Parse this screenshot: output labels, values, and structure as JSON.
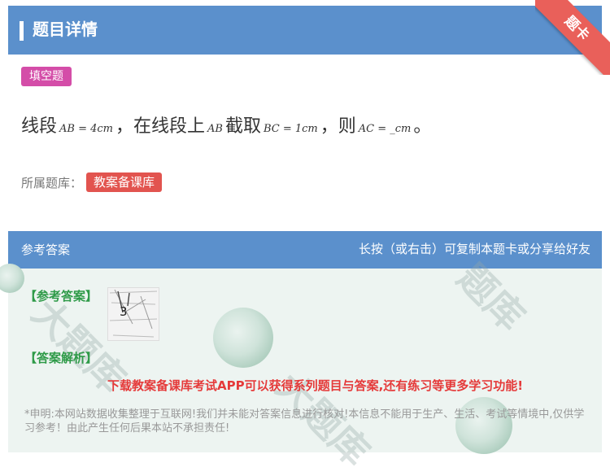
{
  "header": {
    "title": "题目详情",
    "ribbon": "题卡"
  },
  "question": {
    "type_tag": "填空题",
    "text_1": "线段",
    "math_1": "AB = 4cm",
    "text_2": "，在线段上",
    "math_2": "AB",
    "text_3": "截取",
    "math_3": "BC = 1cm",
    "text_4": "，则",
    "math_4": "AC = _cm",
    "text_5": "。",
    "bank_label": "所属题库：",
    "bank_name": "教案备课库"
  },
  "answer": {
    "header_left": "参考答案",
    "header_right": "长按（或右击）可复制本题卡或分享给好友",
    "ref_label": "【参考答案】",
    "answer_value": "3",
    "analysis_label": "【答案解析】",
    "promo": "下载教案备课库考试APP可以获得系列题目与答案,还有练习等更多学习功能!",
    "disclaimer": "*申明:本网站数据收集整理于互联网!我们并未能对答案信息进行核对!本信息不能用于生产、生活、考试等情境中,仅供学习参考！由此产生任何后果本站不承担责任!"
  },
  "colors": {
    "header_blue": "#5b90cc",
    "type_tag": "#d44da8",
    "bank_tag": "#e2544f",
    "section_green": "#2e9a48",
    "promo_red": "#e53a3a"
  }
}
